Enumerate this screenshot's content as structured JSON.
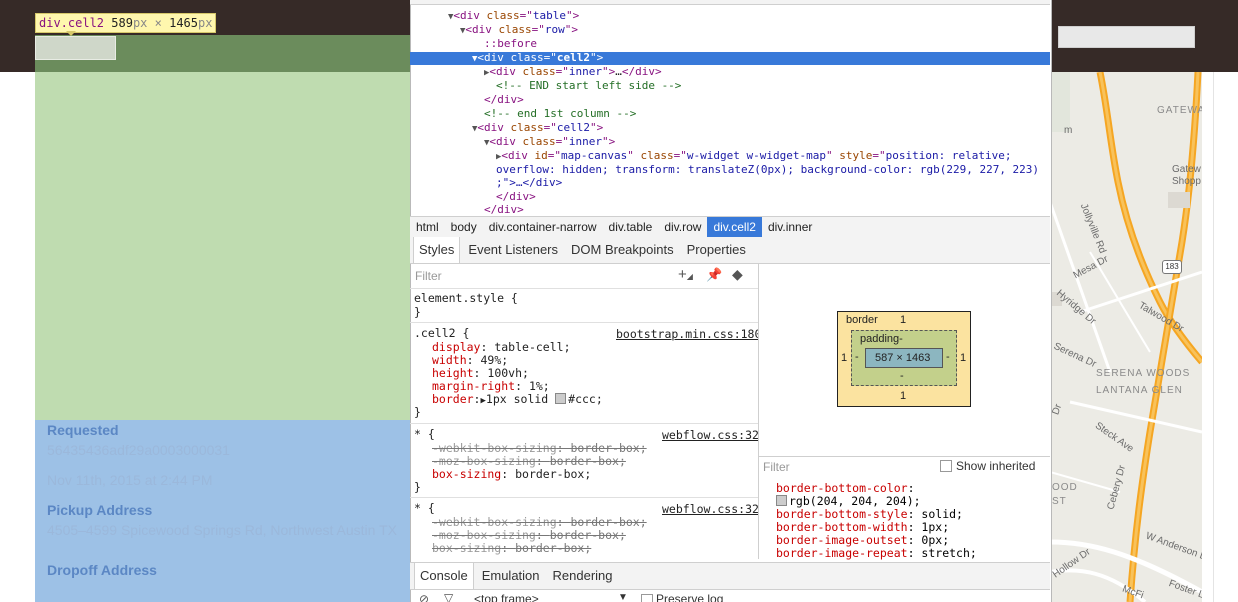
{
  "tooltip": {
    "selector": "div.cell2",
    "width_value": "589",
    "width_unit": "px",
    "times": "×",
    "height_value": "1465",
    "height_unit": "px"
  },
  "page": {
    "fields": [
      {
        "label": "Requested",
        "values": [
          "56435436adf29a0003000031",
          "Nov 11th, 2015 at 2:44 PM"
        ]
      },
      {
        "label": "Pickup Address",
        "values": [
          "4505–4599 Spicewood Springs Rd, Northwest Austin TX"
        ]
      },
      {
        "label": "Dropoff Address",
        "values": []
      }
    ]
  },
  "map": {
    "labels": [
      "GATEWA",
      "Gatew",
      "Shopp",
      "Jollyville Rd",
      "Mesa Dr",
      "183",
      "Talwood Dr",
      "Hyridge Dr",
      "Serena Dr",
      "SERENA WOODS",
      "LANTANA GLEN",
      "Steck Ave",
      "Dr",
      "OOD",
      "ST",
      "Cebery Dr",
      "W Anderson Ln",
      "Hollow Dr",
      "McFi",
      "Foster L",
      "m"
    ]
  },
  "devtools": {
    "dom": {
      "table_open": {
        "tag": "div",
        "attr": "class",
        "value": "table"
      },
      "row_open": {
        "tag": "div",
        "attr": "class",
        "value": "row"
      },
      "pseudo": "::before",
      "cell2_a": {
        "tag": "div",
        "attr": "class",
        "value": "cell2"
      },
      "inner_a": {
        "tag": "div",
        "attr": "class",
        "value": "inner",
        "ellipsis": "…",
        "close": "</div>"
      },
      "comment1": "<!-- END start left side -->",
      "close_div1": "</div>",
      "comment2": "<!-- end 1st column -->",
      "cell2_b": {
        "tag": "div",
        "attr": "class",
        "value": "cell2"
      },
      "inner_b": {
        "tag": "div",
        "attr": "class",
        "value": "inner"
      },
      "map_canvas_line1_attrs": [
        {
          "name": "id",
          "value": "map-canvas"
        },
        {
          "name": "class",
          "value": "w-widget w-widget-map"
        },
        {
          "name": "style",
          "value": "position: relative;"
        }
      ],
      "map_canvas_line2": "overflow: hidden; transform: translateZ(0px); background-color: rgb(229, 227, 223)",
      "map_canvas_line3": ";\">…</div>",
      "close_div2": "</div>",
      "close_div3": "</div>"
    },
    "breadcrumbs": [
      "html",
      "body",
      "div.container-narrow",
      "div.table",
      "div.row",
      "div.cell2",
      "div.inner"
    ],
    "active_breadcrumb": "div.cell2",
    "tabs": [
      "Styles",
      "Event Listeners",
      "DOM Breakpoints",
      "Properties"
    ],
    "active_tab": "Styles",
    "styles": {
      "filter_placeholder": "Filter",
      "toolbar_icons": [
        "add-rule-icon",
        "pin-icon",
        "color-format-icon"
      ],
      "element_style": "element.style {",
      "close_brace": "}",
      "rules": [
        {
          "selector": ".cell2 {",
          "source": "bootstrap.min.css:180",
          "props": [
            {
              "name": "display",
              "value": "table-cell;",
              "struck": false
            },
            {
              "name": "width",
              "value": "49%;",
              "struck": false
            },
            {
              "name": "height",
              "value": "100vh;",
              "struck": false
            },
            {
              "name": "margin-right",
              "value": "1%;",
              "struck": false
            },
            {
              "name": "border",
              "value": "1px solid",
              "value2": "#ccc;",
              "swatch": "#cccccc",
              "struck": false
            }
          ]
        },
        {
          "selector": "* {",
          "source": "webflow.css:32",
          "props": [
            {
              "name": "-webkit-box-sizing",
              "value": "border-box;",
              "struck": true
            },
            {
              "name": "-moz-box-sizing",
              "value": "border-box;",
              "struck": true
            },
            {
              "name": "box-sizing",
              "value": "border-box;",
              "struck": false
            }
          ]
        },
        {
          "selector": "* {",
          "source": "webflow.css:32",
          "props": [
            {
              "name": "-webkit-box-sizing",
              "value": "border-box;",
              "struck": true
            },
            {
              "name": "-moz-box-sizing",
              "value": "border-box;",
              "struck": true
            },
            {
              "name": "box-sizing",
              "value": "border-box;",
              "struck": true
            }
          ]
        }
      ]
    },
    "box_model": {
      "border_label": "border",
      "border_top": "1",
      "border_bottom": "1",
      "border_left": "1",
      "border_right": "1",
      "padding_label": "padding",
      "padding_top": "-",
      "padding_bottom": "-",
      "padding_left": "-",
      "padding_right": "-",
      "content": "587 × 1463"
    },
    "computed": {
      "filter_placeholder": "Filter",
      "show_inherited": "Show inherited",
      "lines": [
        {
          "name": "border-bottom-color",
          "value": ""
        },
        {
          "name": "",
          "value": "rgb(204, 204, 204);",
          "swatch": "#cccccc"
        },
        {
          "name": "border-bottom-style",
          "value": "solid;"
        },
        {
          "name": "border-bottom-width",
          "value": "1px;"
        },
        {
          "name": "border-image-outset",
          "value": "0px;"
        },
        {
          "name": "border-image-repeat",
          "value": "stretch;"
        }
      ]
    },
    "drawer_tabs": [
      "Console",
      "Emulation",
      "Rendering"
    ],
    "active_drawer_tab": "Console",
    "console": {
      "frame": "<top frame>",
      "preserve_log": "Preserve log"
    }
  }
}
